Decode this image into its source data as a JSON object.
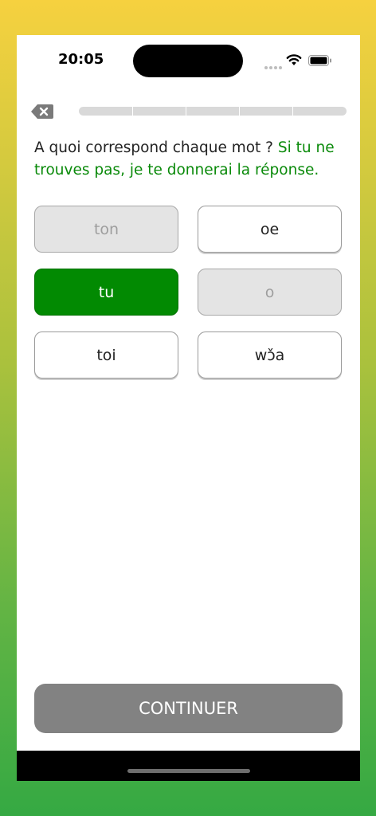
{
  "status_bar": {
    "time": "20:05"
  },
  "progress": {
    "segments": 5,
    "fraction": 0
  },
  "question": {
    "text": "A quoi correspond chaque mot ?",
    "hint": "Si tu ne trouves pas, je te donnerai la réponse."
  },
  "cards": [
    {
      "label": "ton",
      "state": "done"
    },
    {
      "label": "oe",
      "state": "normal"
    },
    {
      "label": "tu",
      "state": "selected"
    },
    {
      "label": "o",
      "state": "done"
    },
    {
      "label": "toi",
      "state": "normal"
    },
    {
      "label": "wɔ̌a",
      "state": "normal"
    }
  ],
  "footer": {
    "continue_label": "CONTINUER"
  },
  "colors": {
    "accent_green": "#028a02",
    "hint_green": "#0a8a0a",
    "continue_gray": "#828282"
  },
  "icons": {
    "back": "backspace-icon",
    "wifi": "wifi-icon",
    "battery": "battery-icon",
    "signal": "signal-icon"
  }
}
